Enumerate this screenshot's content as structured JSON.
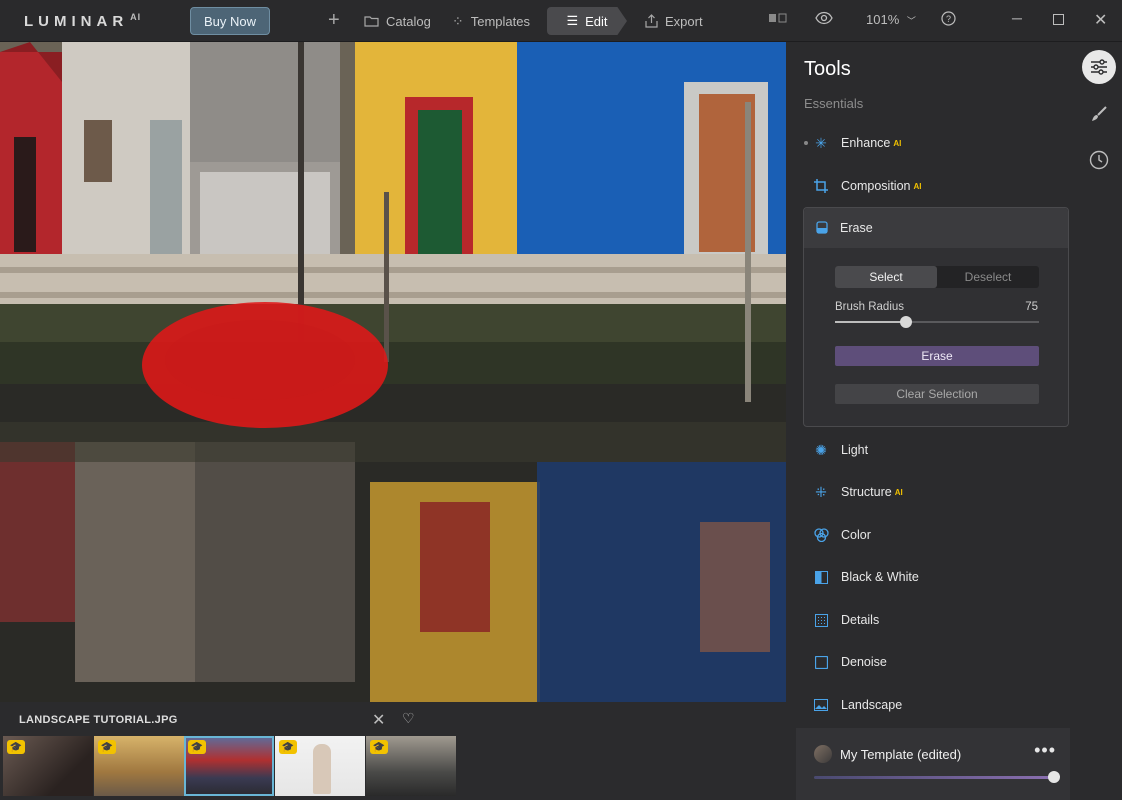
{
  "app": {
    "logo": "LUMINAR",
    "logo_suffix": "AI"
  },
  "topbar": {
    "buy_now": "Buy Now",
    "catalog": "Catalog",
    "templates": "Templates",
    "edit": "Edit",
    "export": "Export",
    "zoom": "101%"
  },
  "filmstrip": {
    "filename": "LANDSCAPE TUTORIAL.JPG",
    "selected_index": 2
  },
  "tools": {
    "title": "Tools",
    "section": "Essentials",
    "items": [
      {
        "label": "Enhance",
        "ai": "AI",
        "icon": "enhance-sparkle-icon"
      },
      {
        "label": "Composition",
        "ai": "AI",
        "icon": "crop-icon"
      },
      {
        "label": "Erase",
        "icon": "eraser-icon"
      },
      {
        "label": "Light",
        "icon": "sun-icon"
      },
      {
        "label": "Structure",
        "ai": "AI",
        "icon": "structure-dots-icon"
      },
      {
        "label": "Color",
        "icon": "color-circles-icon"
      },
      {
        "label": "Black & White",
        "icon": "half-square-icon"
      },
      {
        "label": "Details",
        "icon": "details-grid-icon"
      },
      {
        "label": "Denoise",
        "icon": "denoise-square-icon"
      },
      {
        "label": "Landscape",
        "icon": "landscape-image-icon"
      }
    ],
    "erase_panel": {
      "select": "Select",
      "deselect": "Deselect",
      "brush_radius_label": "Brush Radius",
      "brush_radius_value": "75",
      "brush_radius_fraction": 0.35,
      "erase_button": "Erase",
      "clear_button": "Clear Selection"
    }
  },
  "template": {
    "name": "My Template (edited)",
    "amount_fraction": 1.0
  },
  "colors": {
    "accent_blue": "#4aa3e8",
    "ai_badge": "#f2c200",
    "erase_button": "#5e4e7a",
    "mask_red": "#e01818"
  }
}
